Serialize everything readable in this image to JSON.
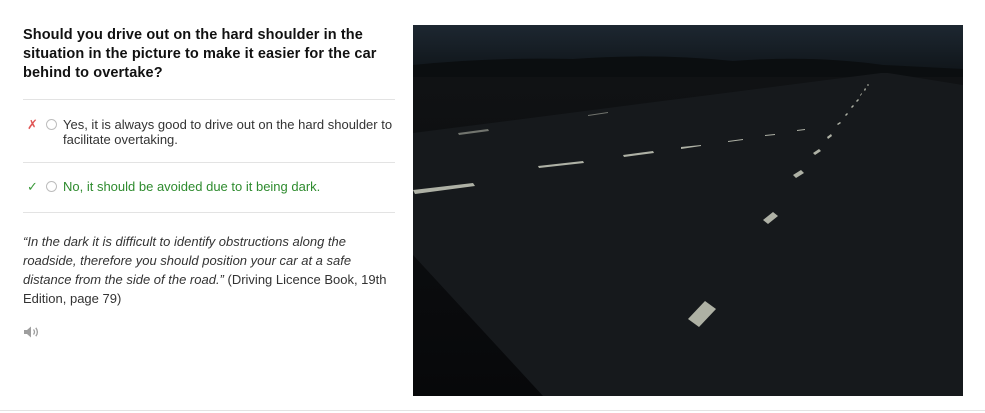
{
  "question": {
    "text": "Should you drive out on the hard shoulder in the situation in the picture to make it easier for the car behind to overtake?"
  },
  "options": [
    {
      "mark": "✗",
      "text": "Yes, it is always good to drive out on the hard shoulder to facilitate overtaking.",
      "status": "incorrect"
    },
    {
      "mark": "✓",
      "text": "No, it should be avoided due to it being dark.",
      "status": "correct"
    }
  ],
  "explanation": {
    "quote": "“In the dark it is difficult to identify obstructions along the roadside, therefore you should position your car at a safe distance from the side of the road.”",
    "source": " (Driving Licence Book, 19th Edition, page 79)"
  },
  "audio": {
    "icon": "speaker-icon"
  },
  "image": {
    "icon": "night-road-photo"
  },
  "colors": {
    "incorrect": "#e05555",
    "correct": "#2e8b2e",
    "photo_bg": "#0b0d0f"
  }
}
